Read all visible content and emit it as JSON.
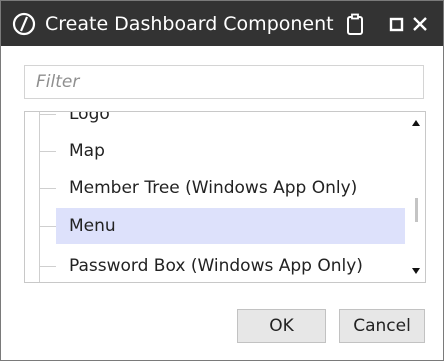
{
  "window": {
    "title": "Create Dashboard Component",
    "icons": [
      "app-logo-icon",
      "clipboard-icon",
      "maximize-icon",
      "close-icon"
    ]
  },
  "filter": {
    "placeholder": "Filter",
    "value": ""
  },
  "list": {
    "items": [
      {
        "label": "Logo",
        "selected": false
      },
      {
        "label": "Map",
        "selected": false
      },
      {
        "label": "Member Tree (Windows App Only)",
        "selected": false
      },
      {
        "label": "Menu",
        "selected": true
      },
      {
        "label": "Password Box (Windows App Only)",
        "selected": false
      }
    ]
  },
  "buttons": {
    "ok": "OK",
    "cancel": "Cancel"
  },
  "colors": {
    "titlebar": "#333333",
    "selection": "#dde1fb",
    "button_bg": "#e7e7e7"
  }
}
